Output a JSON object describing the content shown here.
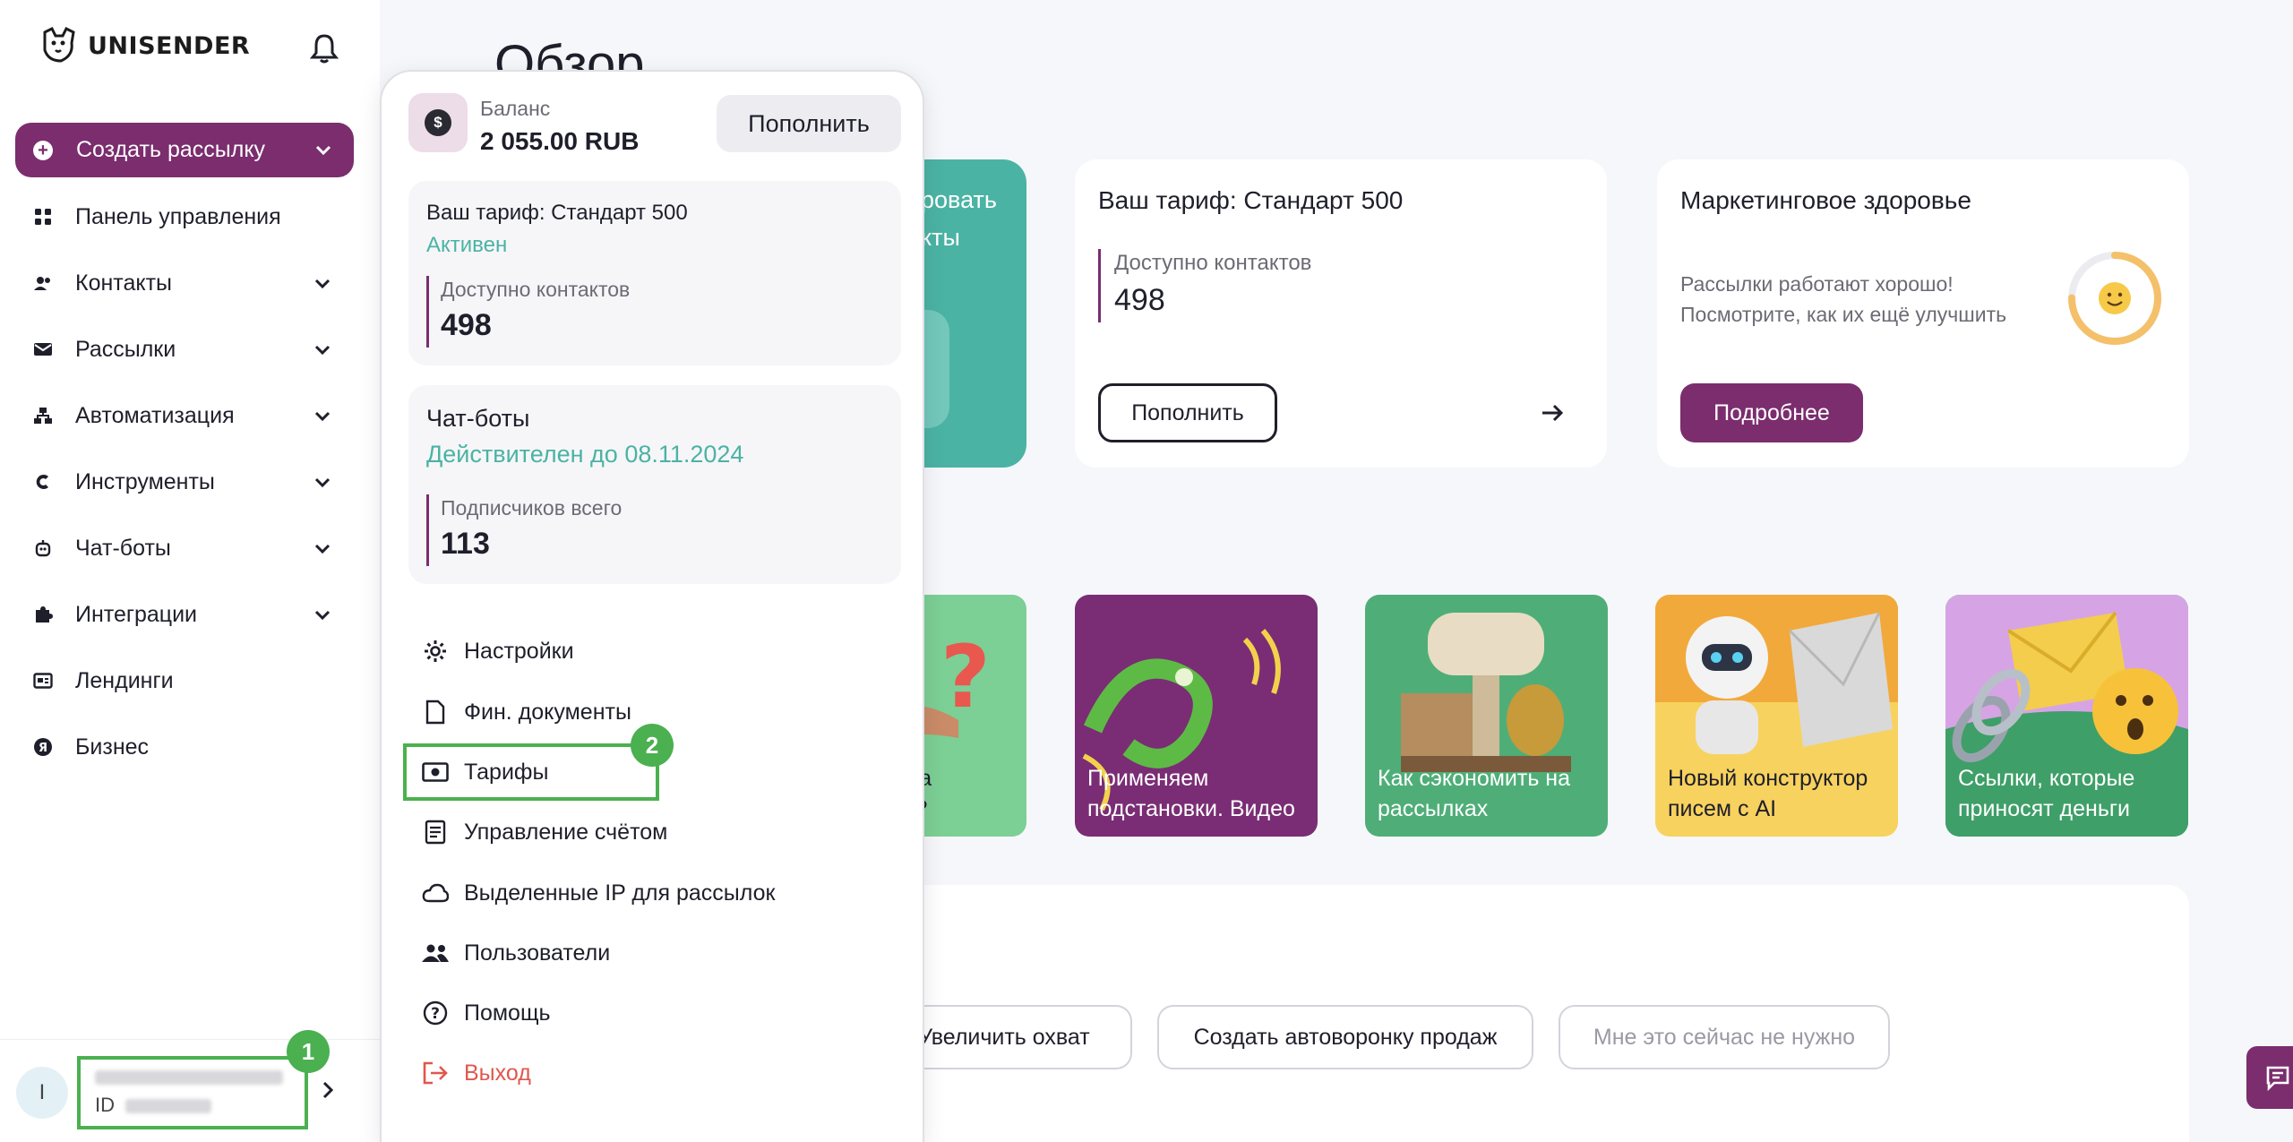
{
  "sidebar": {
    "brand": "UNISENDER",
    "create_label": "Создать рассылку",
    "items": [
      {
        "label": "Панель управления",
        "icon": "grid-icon"
      },
      {
        "label": "Контакты",
        "icon": "contacts-icon"
      },
      {
        "label": "Рассылки",
        "icon": "mail-icon"
      },
      {
        "label": "Автоматизация",
        "icon": "automation-icon"
      },
      {
        "label": "Инструменты",
        "icon": "tools-icon"
      },
      {
        "label": "Чат-боты",
        "icon": "bot-icon"
      },
      {
        "label": "Интеграции",
        "icon": "puzzle-icon"
      },
      {
        "label": "Лендинги",
        "icon": "landing-icon"
      },
      {
        "label": "Бизнес",
        "icon": "business-icon"
      }
    ],
    "user": {
      "avatar_letter": "I",
      "id_label": "ID",
      "badge": "1"
    }
  },
  "main": {
    "title": "Обзор",
    "teal_card": {
      "line1": "ровать",
      "line2": "кты"
    },
    "tariff_card": {
      "title": "Ваш тариф: Стандарт 500",
      "contacts_label": "Доступно контактов",
      "contacts_value": "498",
      "button": "Пополнить"
    },
    "health_card": {
      "title": "Маркетинговое здоровье",
      "text1": "Рассылки работают хорошо!",
      "text2": "Посмотрите, как их ещё улучшить",
      "button": "Подробнее",
      "gauge_level": 0.75
    },
    "tiles": [
      {
        "line1": "о за",
        "line2": "ия?"
      },
      {
        "line1": "Применяем",
        "line2": "подстановки. Видео"
      },
      {
        "line1": "Как сэкономить на",
        "line2": "рассылках"
      },
      {
        "line1": "Новый конструктор",
        "line2": "писем с AI"
      },
      {
        "line1": "Ссылки, которые",
        "line2": "приносят деньги"
      }
    ],
    "goals": [
      "Увеличить охват",
      "Создать автоворонку продаж",
      "Мне это сейчас не нужно"
    ]
  },
  "panel": {
    "balance_label": "Баланс",
    "balance_value": "2 055.00 RUB",
    "topup": "Пополнить",
    "tariff": {
      "title": "Ваш тариф: Стандарт 500",
      "status": "Активен",
      "contacts_label": "Доступно контактов",
      "contacts_value": "498"
    },
    "chatbots": {
      "title": "Чат-боты",
      "valid": "Действителен до 08.11.2024",
      "subs_label": "Подписчиков всего",
      "subs_value": "113"
    },
    "menu": [
      {
        "label": "Настройки",
        "icon": "gear-icon"
      },
      {
        "label": "Фин. документы",
        "icon": "document-icon"
      },
      {
        "label": "Тарифы",
        "icon": "money-icon"
      },
      {
        "label": "Управление счётом",
        "icon": "account-icon"
      },
      {
        "label": "Выделенные IP для рассылок",
        "icon": "cloud-icon"
      },
      {
        "label": "Пользователи",
        "icon": "users-icon"
      },
      {
        "label": "Помощь",
        "icon": "help-icon"
      },
      {
        "label": "Выход",
        "icon": "logout-icon"
      }
    ],
    "badge": "2"
  },
  "colors": {
    "brand": "#7b2d6e",
    "teal": "#4bb3a4",
    "highlight": "#4bb04f",
    "logout": "#e0574d"
  }
}
